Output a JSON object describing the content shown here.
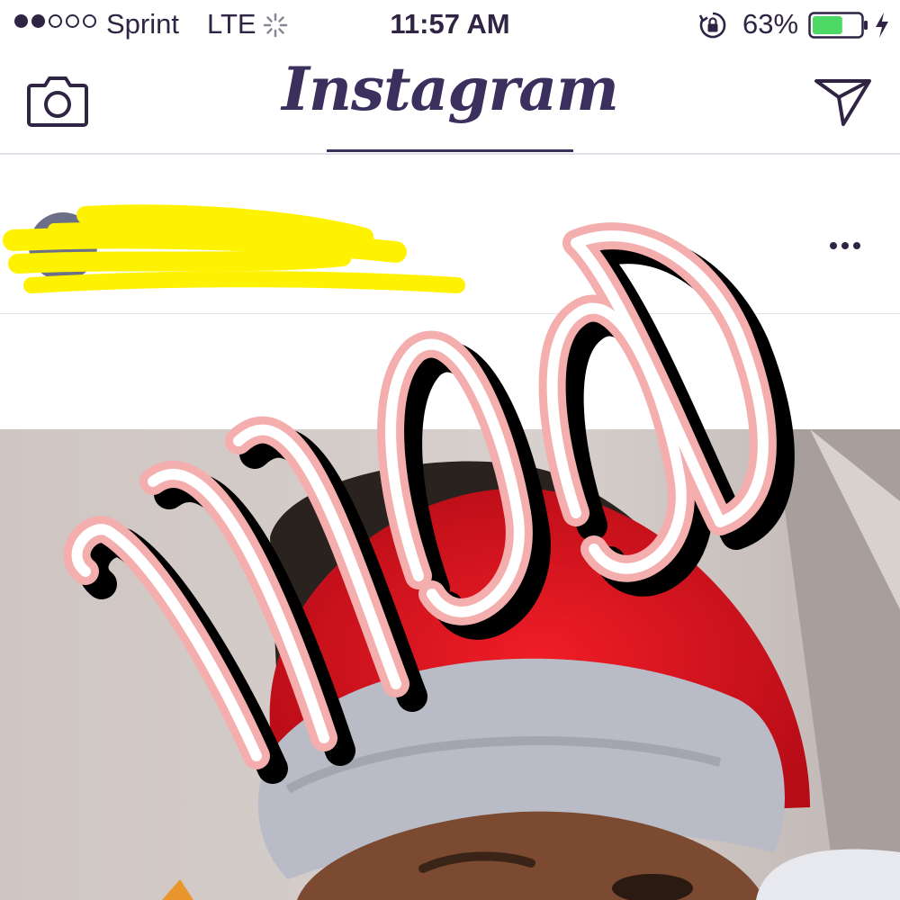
{
  "status_bar": {
    "signal_bars_filled": 2,
    "signal_bars_total": 5,
    "carrier": "Sprint",
    "network": "LTE",
    "time": "11:57 AM",
    "battery_percent_label": "63%",
    "battery_level": 0.63,
    "charging": true
  },
  "nav": {
    "title": "Instagram",
    "camera_icon": "camera-icon",
    "direct_icon": "paper-plane-icon"
  },
  "post": {
    "username_redacted": true,
    "more_icon": "more-dots-icon",
    "sticker_text": "mood"
  },
  "colors": {
    "brand": "#3b2f5e",
    "battery": "#4cd964",
    "redaction": "#fff200",
    "sticker_pink": "#f4aeae",
    "hat_red": "#d8121c"
  }
}
